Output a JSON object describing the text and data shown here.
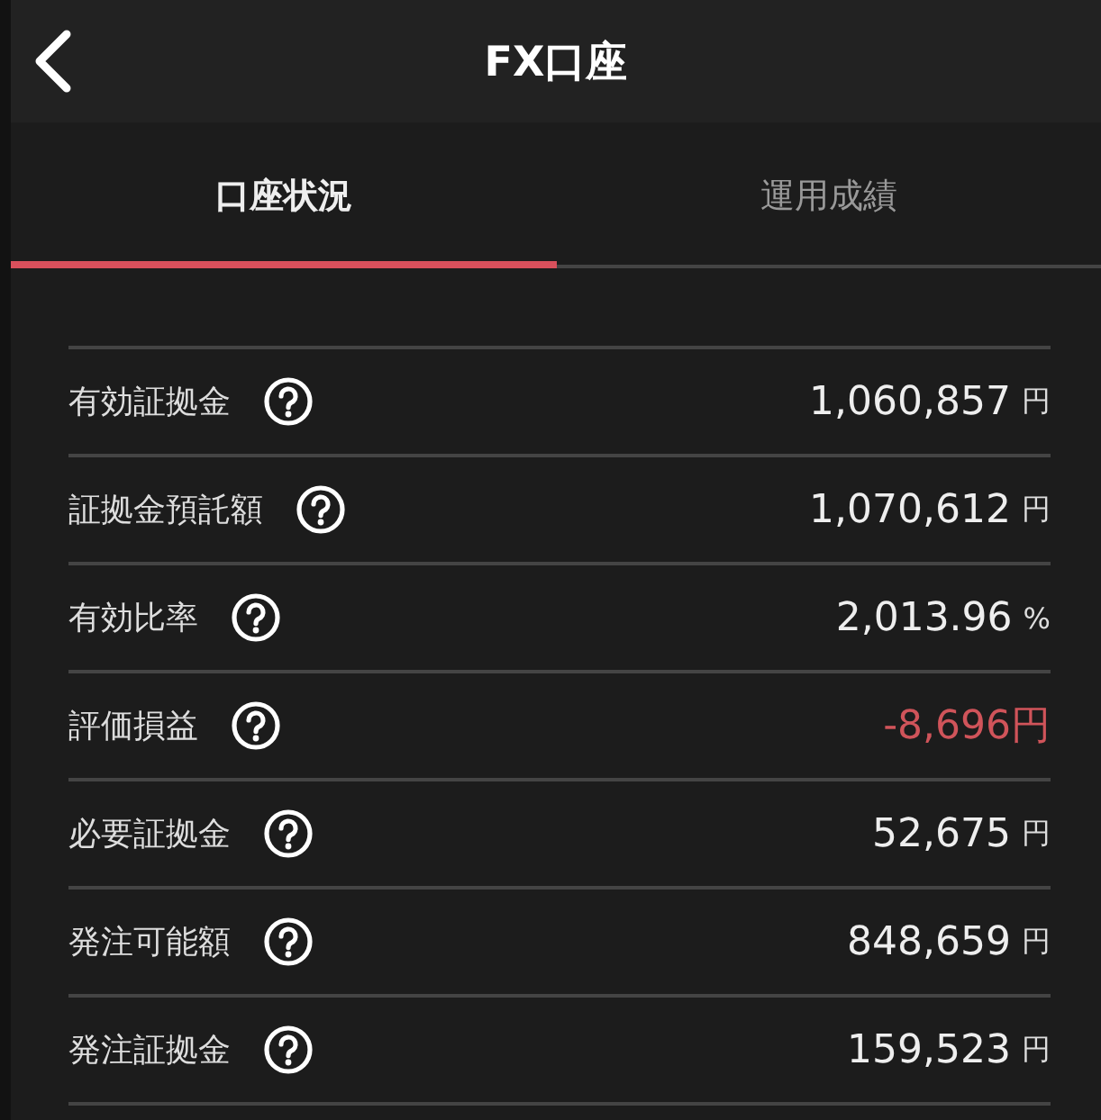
{
  "header": {
    "title": "FX口座"
  },
  "tabs": [
    {
      "label": "口座状況",
      "selected": true
    },
    {
      "label": "運用成績",
      "selected": false
    }
  ],
  "rows": [
    {
      "label": "有効証拠金",
      "help": true,
      "value": "1,060,857",
      "unit": "円",
      "negative": false
    },
    {
      "label": "証拠金預託額",
      "help": true,
      "value": "1,070,612",
      "unit": "円",
      "negative": false
    },
    {
      "label": "有効比率",
      "help": true,
      "value": "2,013.96",
      "unit": "%",
      "negative": false
    },
    {
      "label": "評価損益",
      "help": true,
      "value": "-8,696円",
      "negative": true
    },
    {
      "label": "必要証拠金",
      "help": true,
      "value": "52,675",
      "unit": "円",
      "negative": false
    },
    {
      "label": "発注可能額",
      "help": true,
      "value": "848,659",
      "unit": "円",
      "negative": false
    },
    {
      "label": "発注証拠金",
      "help": true,
      "value": "159,523",
      "unit": "円",
      "negative": false
    }
  ]
}
